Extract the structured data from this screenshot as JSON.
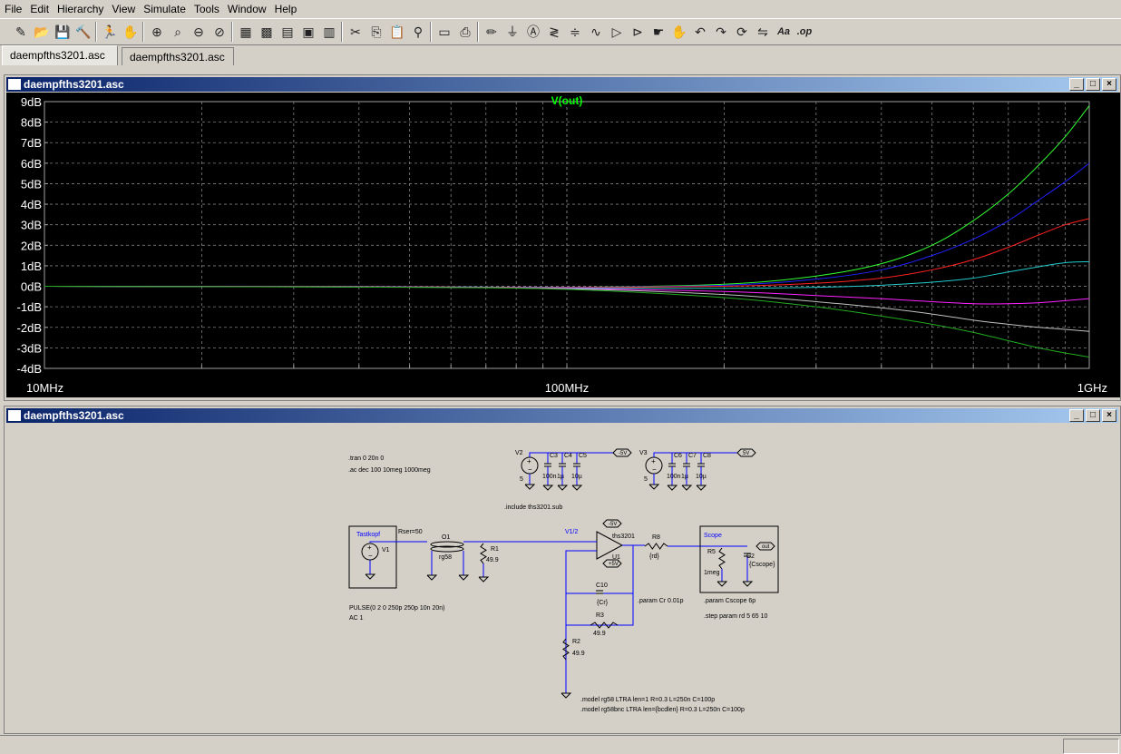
{
  "menu": [
    "File",
    "Edit",
    "Hierarchy",
    "View",
    "Simulate",
    "Tools",
    "Window",
    "Help"
  ],
  "toolbar_icons": [
    "new-schematic-icon",
    "open-icon",
    "save-icon",
    "control-panel-icon",
    "run-icon",
    "halt-icon",
    "zoom-in-icon",
    "zoom-full-icon",
    "zoom-out-icon",
    "cancel-zoom-icon",
    "autorange-icon",
    "grid-icon",
    "tile-horizontal-icon",
    "cascade-icon",
    "tile-vertical-icon",
    "cut-icon",
    "copy-icon",
    "paste-icon",
    "find-icon",
    "print-setup-icon",
    "print-icon",
    "draw-wire-icon",
    "ground-icon",
    "label-net-icon",
    "resistor-icon",
    "capacitor-icon",
    "inductor-icon",
    "diode-icon",
    "component-icon",
    "move-icon",
    "drag-icon",
    "undo-icon",
    "redo-icon",
    "rotate-icon",
    "mirror-icon",
    "text-icon",
    "spice-directive-icon"
  ],
  "tabs": [
    "daempfths3201.asc",
    "daempfths3201.asc"
  ],
  "plot_window": {
    "title": "daempfths3201.asc"
  },
  "schematic_window": {
    "title": "daempfths3201.asc"
  },
  "chart_data": {
    "type": "line",
    "title": "V(out)",
    "xlabel": "",
    "ylabel": "",
    "x_scale": "log",
    "x_ticks": [
      "10MHz",
      "100MHz",
      "1GHz"
    ],
    "y_ticks": [
      "9dB",
      "8dB",
      "7dB",
      "6dB",
      "5dB",
      "4dB",
      "3dB",
      "2dB",
      "1dB",
      "0dB",
      "-1dB",
      "-2dB",
      "-3dB",
      "-4dB"
    ],
    "xlim": [
      10000000,
      1000000000
    ],
    "ylim": [
      -4,
      9
    ],
    "grid": true,
    "colors": {
      "background": "#000000",
      "grid": "#808080",
      "title": "#00ff00",
      "tick": "#ffffff"
    },
    "x": [
      10000000,
      50000000,
      100000000,
      200000000,
      300000000,
      400000000,
      500000000,
      600000000,
      700000000,
      800000000,
      900000000,
      1000000000
    ],
    "series": [
      {
        "color": "#33ff33",
        "values": [
          0,
          -0.02,
          -0.05,
          0.1,
          0.5,
          1.1,
          2.0,
          3.2,
          4.5,
          5.9,
          7.3,
          8.8
        ]
      },
      {
        "color": "#2222ff",
        "values": [
          0,
          -0.02,
          -0.05,
          0.05,
          0.35,
          0.8,
          1.5,
          2.3,
          3.2,
          4.2,
          5.1,
          6.0
        ]
      },
      {
        "color": "#ff2222",
        "values": [
          0,
          -0.02,
          -0.06,
          0.0,
          0.15,
          0.4,
          0.8,
          1.3,
          1.9,
          2.5,
          3.0,
          3.3
        ]
      },
      {
        "color": "#22cccc",
        "values": [
          0,
          -0.03,
          -0.08,
          -0.1,
          -0.05,
          0.05,
          0.2,
          0.4,
          0.7,
          0.95,
          1.15,
          1.2
        ]
      },
      {
        "color": "#ff22ff",
        "values": [
          0,
          -0.03,
          -0.1,
          -0.25,
          -0.45,
          -0.6,
          -0.75,
          -0.85,
          -0.85,
          -0.8,
          -0.7,
          -0.6
        ]
      },
      {
        "color": "#c0c0c0",
        "values": [
          0,
          -0.04,
          -0.12,
          -0.4,
          -0.75,
          -1.05,
          -1.35,
          -1.65,
          -1.85,
          -2.0,
          -2.1,
          -2.2
        ]
      },
      {
        "color": "#22aa22",
        "values": [
          0,
          -0.05,
          -0.15,
          -0.55,
          -1.0,
          -1.45,
          -1.85,
          -2.25,
          -2.65,
          -3.0,
          -3.25,
          -3.45
        ]
      }
    ]
  },
  "schematic": {
    "directives": [
      ".tran 0 20n 0",
      ".ac dec 100 10meg 1000meg"
    ],
    "include": ".include ths3201.sub",
    "v2": {
      "name": "V2",
      "val": "5",
      "caps": [
        "C3",
        "C4",
        "C5"
      ],
      "capvals": [
        "100n",
        "1µ",
        "10µ"
      ],
      "label": "-5V"
    },
    "v3": {
      "name": "V3",
      "val": "5",
      "caps": [
        "C6",
        "C7",
        "C8"
      ],
      "capvals": [
        "100n",
        "1µ",
        "10µ"
      ],
      "label": "5V"
    },
    "tastkopf": {
      "title": "Tastkopf",
      "v1": "V1",
      "rser": "Rser=50",
      "pulse": "PULSE(0 2 0 250p 250p 10n 20n)",
      "ac": "AC 1"
    },
    "o1": {
      "name": "O1",
      "model": "rg58"
    },
    "r1": {
      "name": "R1",
      "val": "49.9"
    },
    "v12": "V1/2",
    "opamp": {
      "name": "U1",
      "model": "ths3201",
      "top": "-5V",
      "bottom": "+5V"
    },
    "r8": {
      "name": "R8",
      "val": "{rd}"
    },
    "c10": {
      "name": "C10",
      "val": "{Cr}"
    },
    "r3": {
      "name": "R3",
      "val": "49.9"
    },
    "r2": {
      "name": "R2",
      "val": "49.9"
    },
    "param_cr": ".param Cr 0.01p",
    "scope": {
      "title": "Scope",
      "r5": "R5",
      "r5val": "1meg",
      "c2": "C2",
      "c2val": "{Cscope}",
      "out": "out"
    },
    "param_cscope": ".param Cscope 6p",
    "step": ".step param rd 5 65 10",
    "models": [
      ".model rg58 LTRA len=1 R=0.3 L=250n C=100p",
      ".model rg58bnc LTRA len={bcdlen} R=0.3 L=250n C=100p"
    ]
  }
}
